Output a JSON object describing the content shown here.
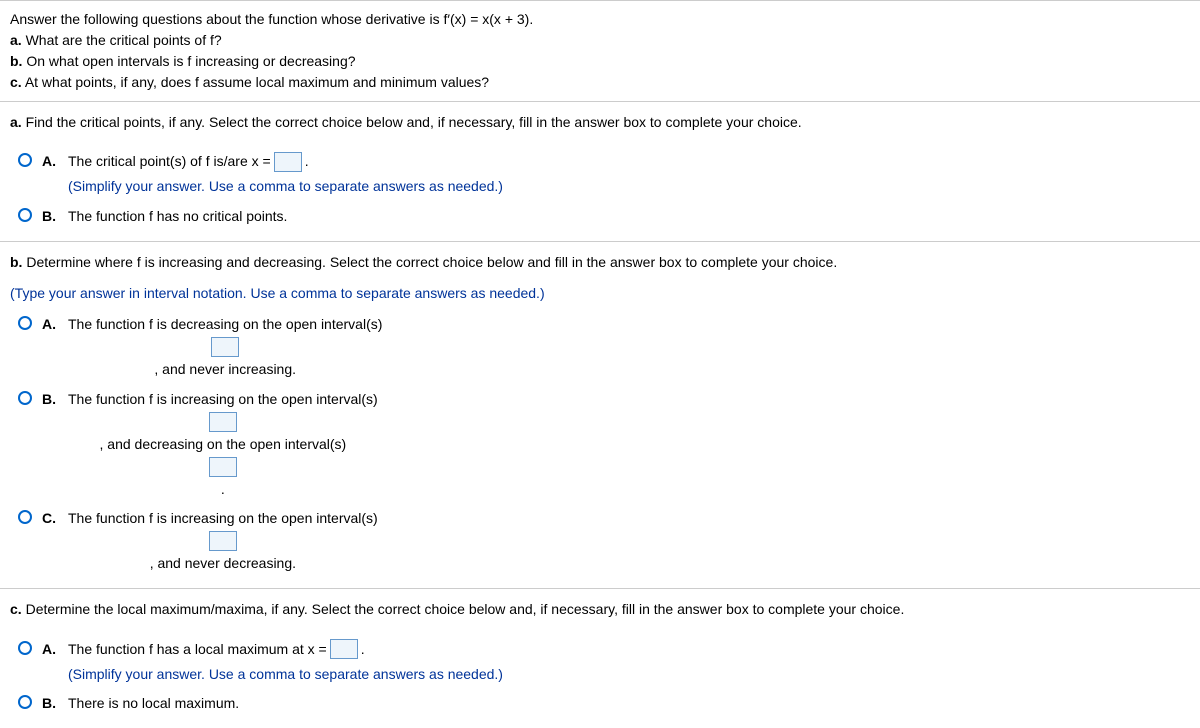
{
  "header": {
    "intro": "Answer the following questions about the function whose derivative is f′(x) = x(x + 3).",
    "a": "What are the critical points of f?",
    "b": "On what open intervals is f increasing or decreasing?",
    "c": "At what points, if any, does f assume local maximum and minimum values?",
    "label_a": "a.",
    "label_b": "b.",
    "label_c": "c."
  },
  "part_a": {
    "prompt_label": "a.",
    "prompt": "Find the critical points, if any. Select the correct choice below and, if necessary, fill in the answer box to complete your choice.",
    "choices": {
      "A": {
        "label": "A.",
        "text_before": "The critical point(s) of f is/are x =",
        "text_after": ".",
        "hint": "(Simplify your answer. Use a comma to separate answers as needed.)"
      },
      "B": {
        "label": "B.",
        "text": "The function f has no critical points."
      }
    }
  },
  "part_b": {
    "prompt_label": "b.",
    "prompt": "Determine where f is increasing and decreasing. Select the correct choice below and fill in the answer box to complete your choice.",
    "hint": "(Type your answer in interval notation. Use a comma to separate answers as needed.)",
    "choices": {
      "A": {
        "label": "A.",
        "before": "The function f is decreasing on the open interval(s)",
        "after": ", and never increasing."
      },
      "B": {
        "label": "B.",
        "before": "The function f is increasing on the open interval(s)",
        "mid": ", and decreasing on the open interval(s)",
        "after": "."
      },
      "C": {
        "label": "C.",
        "before": "The function f is increasing on the open interval(s)",
        "after": ", and never decreasing."
      }
    }
  },
  "part_c": {
    "prompt_label": "c.",
    "prompt": "Determine the local maximum/maxima, if any. Select the correct choice below and, if necessary, fill in the answer box to complete your choice.",
    "choices": {
      "A": {
        "label": "A.",
        "before": "The function f has a local maximum at x =",
        "after": ".",
        "hint": "(Simplify your answer. Use a comma to separate answers as needed.)"
      },
      "B": {
        "label": "B.",
        "text": "There is no local maximum."
      }
    }
  }
}
